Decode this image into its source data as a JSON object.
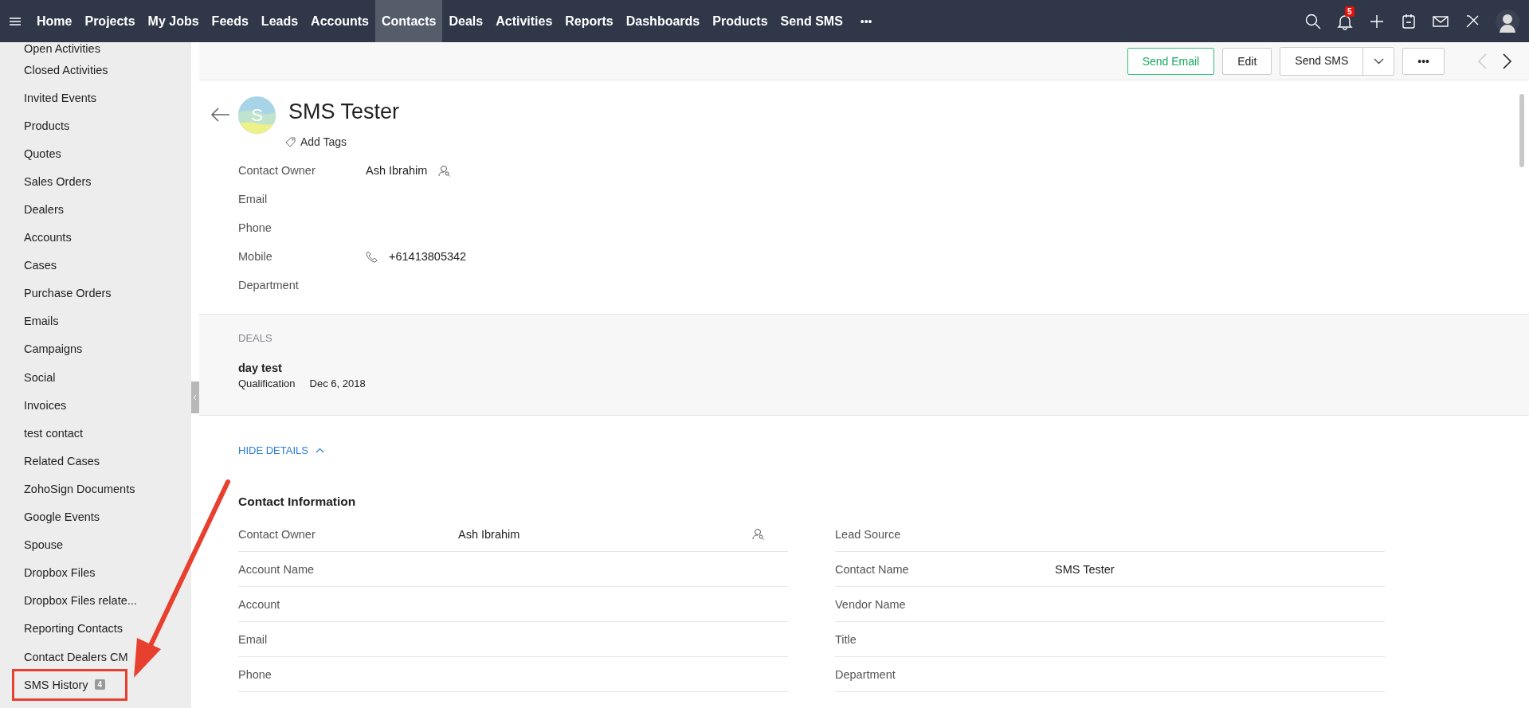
{
  "nav": {
    "tabs": [
      {
        "label": "Home",
        "selected": false
      },
      {
        "label": "Projects",
        "selected": false
      },
      {
        "label": "My Jobs",
        "selected": false
      },
      {
        "label": "Feeds",
        "selected": false
      },
      {
        "label": "Leads",
        "selected": false
      },
      {
        "label": "Accounts",
        "selected": false
      },
      {
        "label": "Contacts",
        "selected": true
      },
      {
        "label": "Deals",
        "selected": false
      },
      {
        "label": "Activities",
        "selected": false
      },
      {
        "label": "Reports",
        "selected": false
      },
      {
        "label": "Dashboards",
        "selected": false
      },
      {
        "label": "Products",
        "selected": false
      },
      {
        "label": "Send SMS",
        "selected": false
      }
    ],
    "more": "•••",
    "notification_count": "5"
  },
  "sidebar": {
    "items": [
      {
        "label": "Open Activities",
        "highlighted": false
      },
      {
        "label": "Closed Activities",
        "highlighted": false
      },
      {
        "label": "Invited Events",
        "highlighted": false
      },
      {
        "label": "Products",
        "highlighted": false
      },
      {
        "label": "Quotes",
        "highlighted": false
      },
      {
        "label": "Sales Orders",
        "highlighted": false
      },
      {
        "label": "Dealers",
        "highlighted": false
      },
      {
        "label": "Accounts",
        "highlighted": false
      },
      {
        "label": "Cases",
        "highlighted": false
      },
      {
        "label": "Purchase Orders",
        "highlighted": false
      },
      {
        "label": "Emails",
        "highlighted": false
      },
      {
        "label": "Campaigns",
        "highlighted": false
      },
      {
        "label": "Social",
        "highlighted": false
      },
      {
        "label": "Invoices",
        "highlighted": false
      },
      {
        "label": "test contact",
        "highlighted": false
      },
      {
        "label": "Related Cases",
        "highlighted": false
      },
      {
        "label": "ZohoSign Documents",
        "highlighted": false
      },
      {
        "label": "Google Events",
        "highlighted": false
      },
      {
        "label": "Spouse",
        "highlighted": false
      },
      {
        "label": "Dropbox Files",
        "highlighted": false
      },
      {
        "label": "Dropbox Files relate...",
        "highlighted": false
      },
      {
        "label": "Reporting Contacts",
        "highlighted": false
      },
      {
        "label": "Contact Dealers CM",
        "highlighted": false
      },
      {
        "label": "SMS History",
        "count": "4",
        "highlighted": true
      }
    ]
  },
  "toolbar": {
    "send_email": "Send Email",
    "edit": "Edit",
    "send_sms": "Send SMS",
    "more": "•••",
    "previous_disabled": true,
    "next_disabled": false
  },
  "record": {
    "avatar_letter": "S",
    "name": "SMS Tester",
    "add_tags": "Add Tags",
    "fields": [
      {
        "label": "Contact Owner",
        "value": "Ash Ibrahim",
        "kind": "user"
      },
      {
        "label": "Email",
        "kind": "text"
      },
      {
        "label": "Phone",
        "kind": "text"
      },
      {
        "label": "Mobile",
        "value": "+61413805342",
        "kind": "phone"
      },
      {
        "label": "Department",
        "kind": "text"
      }
    ]
  },
  "deals": {
    "heading": "DEALS",
    "items": [
      {
        "name": "day test",
        "stage": "Qualification",
        "date": "Dec 6, 2018"
      }
    ]
  },
  "hide_details": "HIDE DETAILS",
  "contact_information": {
    "heading": "Contact Information",
    "left": [
      {
        "label": "Contact Owner",
        "value": "Ash Ibrahim",
        "kind": "user"
      },
      {
        "label": "Account Name",
        "kind": "text"
      },
      {
        "label": "Account",
        "kind": "text"
      },
      {
        "label": "Email",
        "kind": "text"
      },
      {
        "label": "Phone",
        "kind": "text"
      }
    ],
    "right": [
      {
        "label": "Lead Source",
        "kind": "text"
      },
      {
        "label": "Contact Name",
        "value": "SMS Tester",
        "kind": "text"
      },
      {
        "label": "Vendor Name",
        "kind": "text"
      },
      {
        "label": "Title",
        "kind": "text"
      },
      {
        "label": "Department",
        "kind": "text"
      }
    ]
  }
}
